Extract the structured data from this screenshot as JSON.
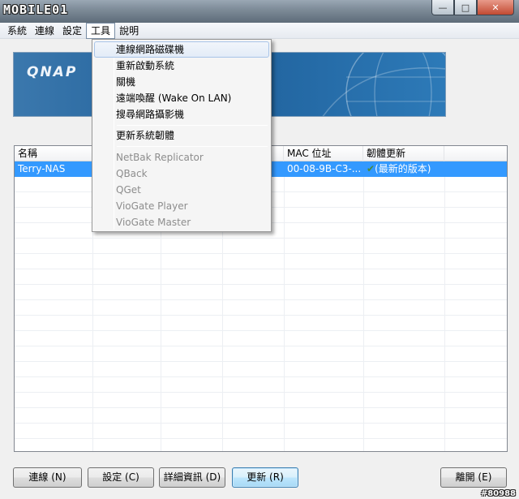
{
  "titlebar": {
    "watermark": "MOBILE01"
  },
  "menubar": {
    "items": [
      "系統",
      "連線",
      "設定",
      "工具",
      "說明"
    ],
    "active_index": 3
  },
  "banner": {
    "logo": "QNAP"
  },
  "tools_menu": {
    "items": [
      {
        "label": "連線網路磁碟機",
        "enabled": true,
        "highlighted": true
      },
      {
        "label": "重新啟動系統",
        "enabled": true
      },
      {
        "label": "關機",
        "enabled": true
      },
      {
        "label": "遠端喚醒 (Wake On LAN)",
        "enabled": true
      },
      {
        "label": "搜尋網路攝影機",
        "enabled": true
      },
      {
        "label": "更新系統韌體",
        "enabled": true
      },
      {
        "label": "NetBak Replicator",
        "enabled": false
      },
      {
        "label": "QBack",
        "enabled": false
      },
      {
        "label": "QGet",
        "enabled": false
      },
      {
        "label": "VioGate Player",
        "enabled": false
      },
      {
        "label": "VioGate Master",
        "enabled": false
      }
    ]
  },
  "list": {
    "columns": [
      "名稱",
      "MAC 位址",
      "韌體更新"
    ],
    "rows": [
      {
        "name": "Terry-NAS",
        "mac": "00-08-9B-C3-...",
        "firmware": "(最新的版本)",
        "selected": true
      }
    ]
  },
  "buttons": {
    "connect": "連線 (N)",
    "settings": "設定 (C)",
    "details": "詳細資訊 (D)",
    "update": "更新 (R)",
    "exit": "離開 (E)"
  },
  "credit": "#80988",
  "colors": {
    "selection": "#3399ff",
    "banner": "#1f5f99"
  }
}
